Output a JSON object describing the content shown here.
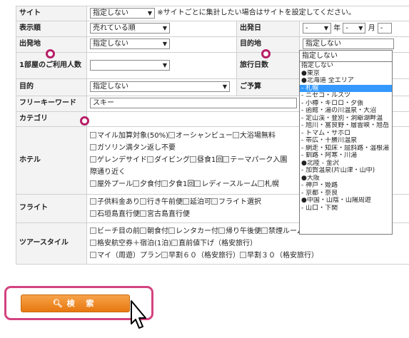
{
  "rows": {
    "site": {
      "label": "サイト",
      "select": "指定しない",
      "note": "※サイトごとに集計したい場合はサイトを設定してください。"
    },
    "order": {
      "label": "表示順",
      "select": "売れている順"
    },
    "departure_date": {
      "label": "出発日",
      "sep_year": "年",
      "sep_month": "月",
      "select_year": "-",
      "select_month": "-",
      "select_day": "-"
    },
    "origin": {
      "label": "出発地",
      "select": "指定しない"
    },
    "destination": {
      "label": "目的地",
      "select": "指定しない"
    },
    "travelers": {
      "label": "1部屋のご利用人数",
      "select": ""
    },
    "days": {
      "label": "旅行日数"
    },
    "purpose": {
      "label": "目的",
      "select": "指定しない"
    },
    "budget": {
      "label": "ご予算"
    },
    "keyword": {
      "label": "フリーキーワード",
      "value": "スキー"
    },
    "category": {
      "label": "カテゴリ"
    },
    "hotel": {
      "label": "ホテル",
      "lines": [
        [
          "マイル加算対象(50%)",
          "オーシャンビュー",
          "大浴場無料"
        ],
        [
          "ガソリン満タン返し不要"
        ],
        [
          "ゲレンデサイド",
          "ダイビング",
          "昼食1回",
          "テーマパーク入園"
        ],
        [
          "際通り近く"
        ],
        [
          "屋外プール",
          "夕食付",
          "夕食1回",
          "レディースルーム",
          "札幌"
        ]
      ]
    },
    "flight": {
      "label": "フライト",
      "lines": [
        [
          "子供料金あり",
          "行き午前便",
          "延泊可",
          "フライト選択"
        ],
        [
          "石垣島直行便",
          "宮古島直行便"
        ]
      ]
    },
    "tour": {
      "label": "ツアースタイル",
      "lines": [
        [
          "ビーチ目の前",
          "朝食付",
          "レンタカー付",
          "帰り午後便",
          "禁煙ルーム"
        ],
        [
          "格安航空券＋宿泊(1泊)",
          "直前値下げ（格安旅行）"
        ],
        [
          "マイ（周遊）プラン",
          "早割６０（格安旅行）",
          "早割３０（格安旅行）"
        ]
      ]
    }
  },
  "dropdown": {
    "header": "指定しない",
    "items": [
      "指定しない",
      "●東京",
      "●北海道 全エリア",
      "- 札幌",
      "- ニセコ・ルスツ",
      "- 小樽・キロロ・夕張",
      "- 函館・湯の川温泉・大沼",
      "- 定山渓・登別・洞爺湖畔温",
      "- 旭川・富良野・層雲峡・旭岳",
      "- トマム・サホロ",
      "- 帯広・十勝川温泉",
      "- 網走・知床・屈斜路・温根湯",
      "- 釧路・阿寒・川湯",
      "●北陸 - 金沢",
      "- 加賀温泉(片山津・山中)",
      "●大阪",
      "- 神戸・姫路",
      "- 京都・奈良",
      "●中国・山陰・山陽周遊",
      "- 山口・下関"
    ],
    "highlighted_index": 3
  },
  "search_button": {
    "label": "検 索"
  },
  "colors": {
    "accent": "#d3437f",
    "button": "#e8780f",
    "selection": "#3399ff"
  }
}
